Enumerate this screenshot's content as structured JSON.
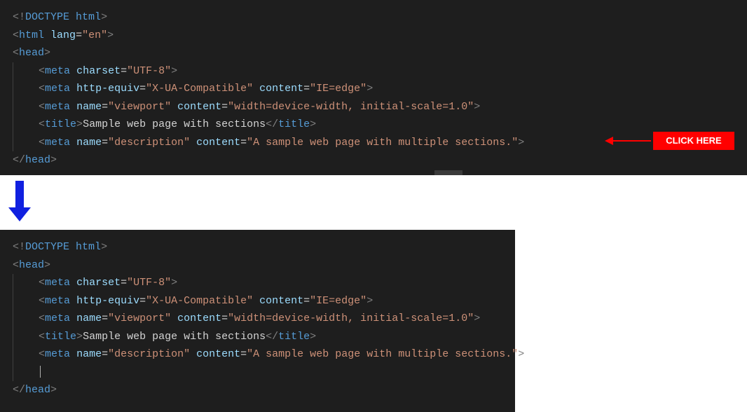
{
  "annotation": {
    "click_here_label": "CLICK HERE"
  },
  "top": {
    "lines": [
      {
        "tokens": [
          {
            "cls": "tok-br",
            "t": "<!"
          },
          {
            "cls": "tok-doctype",
            "t": "DOCTYPE"
          },
          {
            "cls": "tok-txt",
            "t": " "
          },
          {
            "cls": "tok-doctype",
            "t": "html"
          },
          {
            "cls": "tok-br",
            "t": ">"
          }
        ],
        "indent": 0
      },
      {
        "tokens": [
          {
            "cls": "tok-br",
            "t": "<"
          },
          {
            "cls": "tok-tag",
            "t": "html"
          },
          {
            "cls": "tok-txt",
            "t": " "
          },
          {
            "cls": "tok-attr",
            "t": "lang"
          },
          {
            "cls": "tok-txt",
            "t": "="
          },
          {
            "cls": "tok-str",
            "t": "\"en\""
          },
          {
            "cls": "tok-br",
            "t": ">"
          }
        ],
        "indent": 0
      },
      {
        "tokens": [
          {
            "cls": "tok-br",
            "t": "<"
          },
          {
            "cls": "tok-tag",
            "t": "head"
          },
          {
            "cls": "tok-br",
            "t": ">"
          }
        ],
        "indent": 0
      },
      {
        "tokens": [
          {
            "cls": "tok-br",
            "t": "<"
          },
          {
            "cls": "tok-tag",
            "t": "meta"
          },
          {
            "cls": "tok-txt",
            "t": " "
          },
          {
            "cls": "tok-attr",
            "t": "charset"
          },
          {
            "cls": "tok-txt",
            "t": "="
          },
          {
            "cls": "tok-str",
            "t": "\"UTF-8\""
          },
          {
            "cls": "tok-br",
            "t": ">"
          }
        ],
        "indent": 1
      },
      {
        "tokens": [
          {
            "cls": "tok-br",
            "t": "<"
          },
          {
            "cls": "tok-tag",
            "t": "meta"
          },
          {
            "cls": "tok-txt",
            "t": " "
          },
          {
            "cls": "tok-attr",
            "t": "http-equiv"
          },
          {
            "cls": "tok-txt",
            "t": "="
          },
          {
            "cls": "tok-str",
            "t": "\"X-UA-Compatible\""
          },
          {
            "cls": "tok-txt",
            "t": " "
          },
          {
            "cls": "tok-attr",
            "t": "content"
          },
          {
            "cls": "tok-txt",
            "t": "="
          },
          {
            "cls": "tok-str",
            "t": "\"IE=edge\""
          },
          {
            "cls": "tok-br",
            "t": ">"
          }
        ],
        "indent": 1
      },
      {
        "tokens": [
          {
            "cls": "tok-br",
            "t": "<"
          },
          {
            "cls": "tok-tag",
            "t": "meta"
          },
          {
            "cls": "tok-txt",
            "t": " "
          },
          {
            "cls": "tok-attr",
            "t": "name"
          },
          {
            "cls": "tok-txt",
            "t": "="
          },
          {
            "cls": "tok-str",
            "t": "\"viewport\""
          },
          {
            "cls": "tok-txt",
            "t": " "
          },
          {
            "cls": "tok-attr",
            "t": "content"
          },
          {
            "cls": "tok-txt",
            "t": "="
          },
          {
            "cls": "tok-str",
            "t": "\"width=device-width, initial-scale=1.0\""
          },
          {
            "cls": "tok-br",
            "t": ">"
          }
        ],
        "indent": 1
      },
      {
        "tokens": [
          {
            "cls": "tok-br",
            "t": "<"
          },
          {
            "cls": "tok-tag",
            "t": "title"
          },
          {
            "cls": "tok-br",
            "t": ">"
          },
          {
            "cls": "tok-txt",
            "t": "Sample web page with sections"
          },
          {
            "cls": "tok-br",
            "t": "</"
          },
          {
            "cls": "tok-tag",
            "t": "title"
          },
          {
            "cls": "tok-br",
            "t": ">"
          }
        ],
        "indent": 1
      },
      {
        "tokens": [
          {
            "cls": "tok-br",
            "t": "<"
          },
          {
            "cls": "tok-tag",
            "t": "meta"
          },
          {
            "cls": "tok-txt",
            "t": " "
          },
          {
            "cls": "tok-attr",
            "t": "name"
          },
          {
            "cls": "tok-txt",
            "t": "="
          },
          {
            "cls": "tok-str",
            "t": "\"description\""
          },
          {
            "cls": "tok-txt",
            "t": " "
          },
          {
            "cls": "tok-attr",
            "t": "content"
          },
          {
            "cls": "tok-txt",
            "t": "="
          },
          {
            "cls": "tok-str",
            "t": "\"A sample web page with multiple sections.\""
          },
          {
            "cls": "tok-br",
            "t": ">"
          }
        ],
        "indent": 1
      },
      {
        "tokens": [
          {
            "cls": "tok-br",
            "t": "</"
          },
          {
            "cls": "tok-tag",
            "t": "head"
          },
          {
            "cls": "tok-br",
            "t": ">"
          }
        ],
        "indent": 0
      }
    ]
  },
  "bottom": {
    "lines": [
      {
        "tokens": [
          {
            "cls": "tok-br",
            "t": "<!"
          },
          {
            "cls": "tok-doctype",
            "t": "DOCTYPE"
          },
          {
            "cls": "tok-txt",
            "t": " "
          },
          {
            "cls": "tok-doctype",
            "t": "html"
          },
          {
            "cls": "tok-br",
            "t": ">"
          }
        ],
        "indent": 0
      },
      {
        "tokens": [
          {
            "cls": "tok-br",
            "t": "<"
          },
          {
            "cls": "tok-tag",
            "t": "head"
          },
          {
            "cls": "tok-br",
            "t": ">"
          }
        ],
        "indent": 0
      },
      {
        "tokens": [
          {
            "cls": "tok-br",
            "t": "<"
          },
          {
            "cls": "tok-tag",
            "t": "meta"
          },
          {
            "cls": "tok-txt",
            "t": " "
          },
          {
            "cls": "tok-attr",
            "t": "charset"
          },
          {
            "cls": "tok-txt",
            "t": "="
          },
          {
            "cls": "tok-str",
            "t": "\"UTF-8\""
          },
          {
            "cls": "tok-br",
            "t": ">"
          }
        ],
        "indent": 1
      },
      {
        "tokens": [
          {
            "cls": "tok-br",
            "t": "<"
          },
          {
            "cls": "tok-tag",
            "t": "meta"
          },
          {
            "cls": "tok-txt",
            "t": " "
          },
          {
            "cls": "tok-attr",
            "t": "http-equiv"
          },
          {
            "cls": "tok-txt",
            "t": "="
          },
          {
            "cls": "tok-str",
            "t": "\"X-UA-Compatible\""
          },
          {
            "cls": "tok-txt",
            "t": " "
          },
          {
            "cls": "tok-attr",
            "t": "content"
          },
          {
            "cls": "tok-txt",
            "t": "="
          },
          {
            "cls": "tok-str",
            "t": "\"IE=edge\""
          },
          {
            "cls": "tok-br",
            "t": ">"
          }
        ],
        "indent": 1
      },
      {
        "tokens": [
          {
            "cls": "tok-br",
            "t": "<"
          },
          {
            "cls": "tok-tag",
            "t": "meta"
          },
          {
            "cls": "tok-txt",
            "t": " "
          },
          {
            "cls": "tok-attr",
            "t": "name"
          },
          {
            "cls": "tok-txt",
            "t": "="
          },
          {
            "cls": "tok-str",
            "t": "\"viewport\""
          },
          {
            "cls": "tok-txt",
            "t": " "
          },
          {
            "cls": "tok-attr",
            "t": "content"
          },
          {
            "cls": "tok-txt",
            "t": "="
          },
          {
            "cls": "tok-str",
            "t": "\"width=device-width, initial-scale=1.0\""
          },
          {
            "cls": "tok-br",
            "t": ">"
          }
        ],
        "indent": 1
      },
      {
        "tokens": [
          {
            "cls": "tok-br",
            "t": "<"
          },
          {
            "cls": "tok-tag",
            "t": "title"
          },
          {
            "cls": "tok-br",
            "t": ">"
          },
          {
            "cls": "tok-txt",
            "t": "Sample web page with sections"
          },
          {
            "cls": "tok-br",
            "t": "</"
          },
          {
            "cls": "tok-tag",
            "t": "title"
          },
          {
            "cls": "tok-br",
            "t": ">"
          }
        ],
        "indent": 1
      },
      {
        "tokens": [
          {
            "cls": "tok-br",
            "t": "<"
          },
          {
            "cls": "tok-tag",
            "t": "meta"
          },
          {
            "cls": "tok-txt",
            "t": " "
          },
          {
            "cls": "tok-attr",
            "t": "name"
          },
          {
            "cls": "tok-txt",
            "t": "="
          },
          {
            "cls": "tok-str",
            "t": "\"description\""
          },
          {
            "cls": "tok-txt",
            "t": " "
          },
          {
            "cls": "tok-attr",
            "t": "content"
          },
          {
            "cls": "tok-txt",
            "t": "="
          },
          {
            "cls": "tok-str",
            "t": "\"A sample web page with multiple sections.\""
          },
          {
            "cls": "tok-br",
            "t": ">"
          }
        ],
        "indent": 1
      },
      {
        "tokens": [],
        "indent": 1,
        "caret": true
      },
      {
        "tokens": [
          {
            "cls": "tok-br",
            "t": "</"
          },
          {
            "cls": "tok-tag",
            "t": "head"
          },
          {
            "cls": "tok-br",
            "t": ">"
          }
        ],
        "indent": 0
      }
    ]
  }
}
